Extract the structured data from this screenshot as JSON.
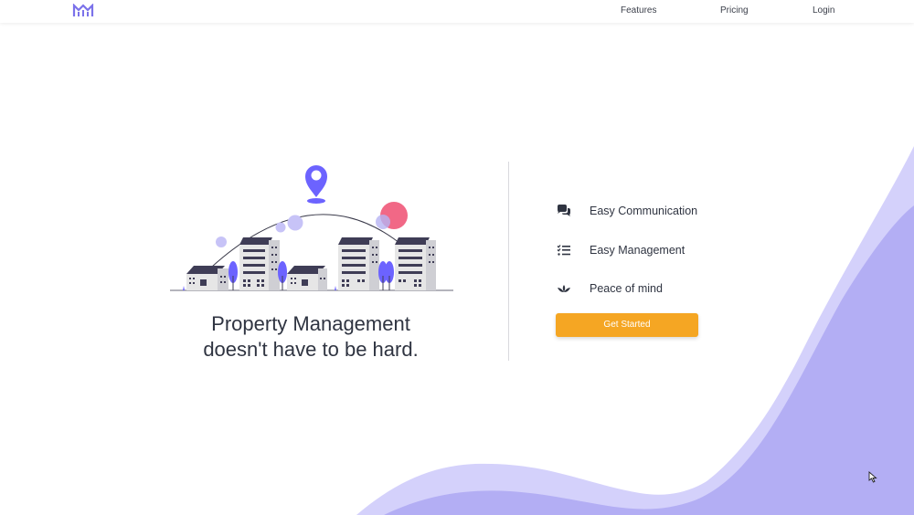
{
  "nav": {
    "links": [
      "Features",
      "Pricing",
      "Login"
    ]
  },
  "hero": {
    "headline_line1": "Property Management",
    "headline_line2": "doesn't have to be hard."
  },
  "features": [
    {
      "icon": "chat-bubbles-icon",
      "label": "Easy Communication"
    },
    {
      "icon": "checklist-icon",
      "label": "Easy Management"
    },
    {
      "icon": "lotus-icon",
      "label": "Peace of mind"
    }
  ],
  "cta_label": "Get Started",
  "colors": {
    "accent": "#6c63ff",
    "cta": "#f5a623",
    "wave_light": "#d4d1fb",
    "wave_dark": "#b3aef4",
    "text": "#2f3441"
  }
}
